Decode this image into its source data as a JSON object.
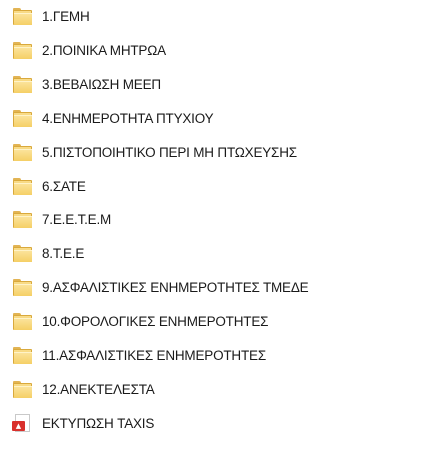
{
  "items": [
    {
      "label": "1.ΓΕΜΗ",
      "icon": "folder-icon"
    },
    {
      "label": "2.ΠΟΙΝΙΚΑ ΜΗΤΡΩΑ",
      "icon": "folder-icon"
    },
    {
      "label": "3.ΒΕΒΑΙΩΣΗ ΜΕΕΠ",
      "icon": "folder-icon"
    },
    {
      "label": "4.ΕΝΗΜΕΡΟΤΗΤΑ ΠΤΥΧΙΟΥ",
      "icon": "folder-icon"
    },
    {
      "label": "5.ΠΙΣΤΟΠΟΙΗΤΙΚΟ ΠΕΡΙ ΜΗ ΠΤΩΧΕΥΣΗΣ",
      "icon": "folder-icon"
    },
    {
      "label": "6.ΣΑΤΕ",
      "icon": "folder-icon"
    },
    {
      "label": "7.Ε.Ε.Τ.Ε.Μ",
      "icon": "folder-icon"
    },
    {
      "label": "8.Τ.Ε.Ε",
      "icon": "folder-icon"
    },
    {
      "label": "9.ΑΣΦΑΛΙΣΤΙΚΕΣ ΕΝΗΜΕΡΟΤΗΤΕΣ ΤΜΕΔΕ",
      "icon": "folder-icon"
    },
    {
      "label": "10.ΦΟΡΟΛΟΓΙΚΕΣ ΕΝΗΜΕΡΟΤΗΤΕΣ",
      "icon": "folder-icon"
    },
    {
      "label": "11.ΑΣΦΑΛΙΣΤΙΚΕΣ ΕΝΗΜΕΡΟΤΗΤΕΣ",
      "icon": "folder-icon"
    },
    {
      "label": "12.ΑΝΕΚΤΕΛΕΣΤΑ",
      "icon": "folder-icon"
    },
    {
      "label": "ΕΚΤΥΠΩΣΗ TAXIS",
      "icon": "pdf-file-icon"
    }
  ],
  "colors": {
    "folder": "#f3c857",
    "pdf_badge": "#d9302c",
    "text": "#1a1a1a"
  }
}
